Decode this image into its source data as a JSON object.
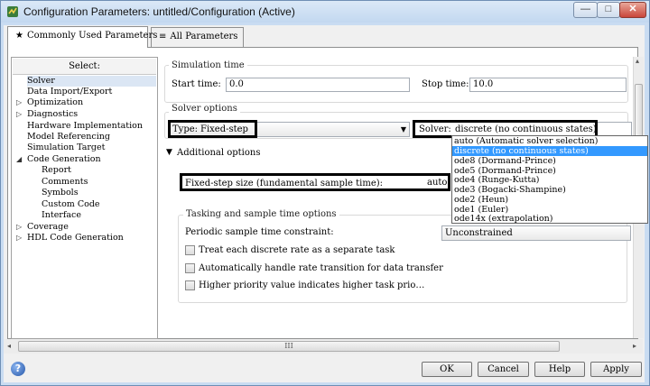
{
  "window": {
    "title": "Configuration Parameters: untitled/Configuration (Active)",
    "minimize": "—",
    "maximize": "□",
    "close": "✕"
  },
  "tabs": [
    {
      "label": "Commonly Used Parameters",
      "icon": "star-icon",
      "glyph": "★"
    },
    {
      "label": "All Parameters",
      "icon": "list-icon",
      "glyph": "≡"
    }
  ],
  "tree": {
    "header": "Select:",
    "items": [
      {
        "label": "Solver",
        "selected": true
      },
      {
        "label": "Data Import/Export"
      },
      {
        "label": "Optimization",
        "expander": "▷"
      },
      {
        "label": "Diagnostics",
        "expander": "▷"
      },
      {
        "label": "Hardware Implementation"
      },
      {
        "label": "Model Referencing"
      },
      {
        "label": "Simulation Target"
      },
      {
        "label": "Code Generation",
        "expander": "◢"
      },
      {
        "label": "Report"
      },
      {
        "label": "Comments"
      },
      {
        "label": "Symbols"
      },
      {
        "label": "Custom Code"
      },
      {
        "label": "Interface"
      },
      {
        "label": "Coverage",
        "expander": "▷"
      },
      {
        "label": "HDL Code Generation",
        "expander": "▷"
      }
    ]
  },
  "simulation_time": {
    "legend": "Simulation time",
    "start_label": "Start time:",
    "start_value": "0.0",
    "stop_label": "Stop time:",
    "stop_value": "10.0"
  },
  "solver_options": {
    "legend": "Solver options",
    "type_label": "Type:",
    "type_value": "Fixed-step",
    "solver_label": "Solver:",
    "solver_value": "discrete (no continuous states)",
    "solver_list": [
      "auto (Automatic solver selection)",
      "discrete (no continuous states)",
      "ode8 (Dormand-Prince)",
      "ode5 (Dormand-Prince)",
      "ode4 (Runge-Kutta)",
      "ode3 (Bogacki-Shampine)",
      "ode2 (Heun)",
      "ode1 (Euler)",
      "ode14x (extrapolation)"
    ],
    "solver_list_selected": 1
  },
  "additional_options": {
    "label": "Additional options",
    "expander": "▼",
    "fixed_step_label": "Fixed-step size (fundamental sample time):",
    "fixed_step_value": "auto"
  },
  "tasking": {
    "legend": "Tasking and sample time options",
    "periodic_label": "Periodic sample time constraint:",
    "periodic_value": "Unconstrained",
    "checkboxes": [
      {
        "label": "Treat each discrete rate as a separate task",
        "checked": false
      },
      {
        "label": "Automatically handle rate transition for data transfer",
        "checked": false
      },
      {
        "label": "Higher priority value indicates higher task prio…",
        "checked": false
      }
    ]
  },
  "scroll": {
    "h_thumb_grip": "III",
    "left": "◂",
    "right": "▸",
    "up": "▴",
    "down": "▾"
  },
  "buttons": {
    "ok": "OK",
    "cancel": "Cancel",
    "help": "Help",
    "apply": "Apply",
    "help_icon": "?"
  }
}
